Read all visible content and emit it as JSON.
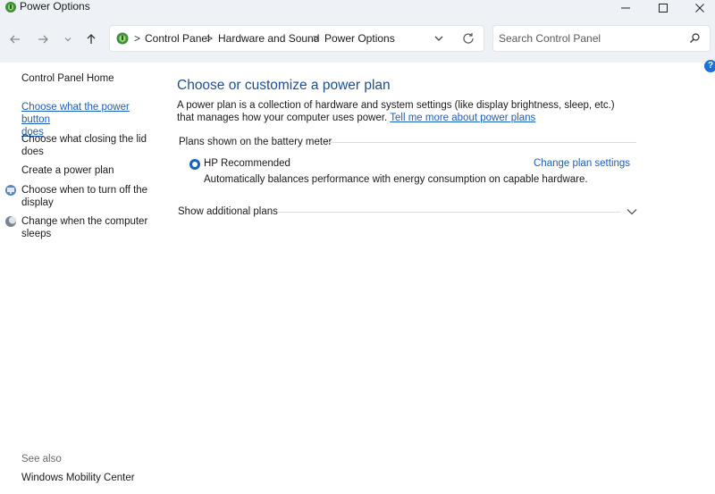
{
  "window": {
    "title": "Power Options"
  },
  "address": {
    "breadcrumbs": [
      "Control Panel",
      "Hardware and Sound",
      "Power Options"
    ],
    "separator": ">"
  },
  "search": {
    "placeholder": "Search Control Panel"
  },
  "sidebar": {
    "home": "Control Panel Home",
    "items": [
      {
        "line1": "Choose what the power button",
        "line2": "does"
      },
      {
        "line1": "Choose what closing the lid",
        "line2": "does"
      },
      {
        "line1": "Create a power plan"
      },
      {
        "line1": "Choose when to turn off the",
        "line2": "display"
      },
      {
        "line1": "Change when the computer",
        "line2": "sleeps"
      }
    ],
    "see_also": "See also",
    "see_also_items": [
      "Windows Mobility Center"
    ]
  },
  "main": {
    "heading": "Choose or customize a power plan",
    "description": "A power plan is a collection of hardware and system settings (like display brightness, sleep, etc.) that manages how your computer uses power.",
    "tell_more_link": "Tell me more about power plans",
    "section_label": "Plans shown on the battery meter",
    "plan": {
      "name": "HP Recommended",
      "description": "Automatically balances performance with energy consumption on capable hardware.",
      "change_link": "Change plan settings",
      "selected": true
    },
    "show_additional": "Show additional plans"
  },
  "help": {
    "label": "?"
  },
  "colors": {
    "accent": "#1c5fb8",
    "heading": "#1c4f94",
    "chrome": "#eef2f7"
  },
  "icons": {
    "app": "power-options-icon",
    "back": "back-arrow-icon",
    "forward": "forward-arrow-icon",
    "recent": "chevron-down-icon",
    "up": "up-arrow-icon",
    "refresh": "refresh-icon",
    "search": "search-icon"
  }
}
